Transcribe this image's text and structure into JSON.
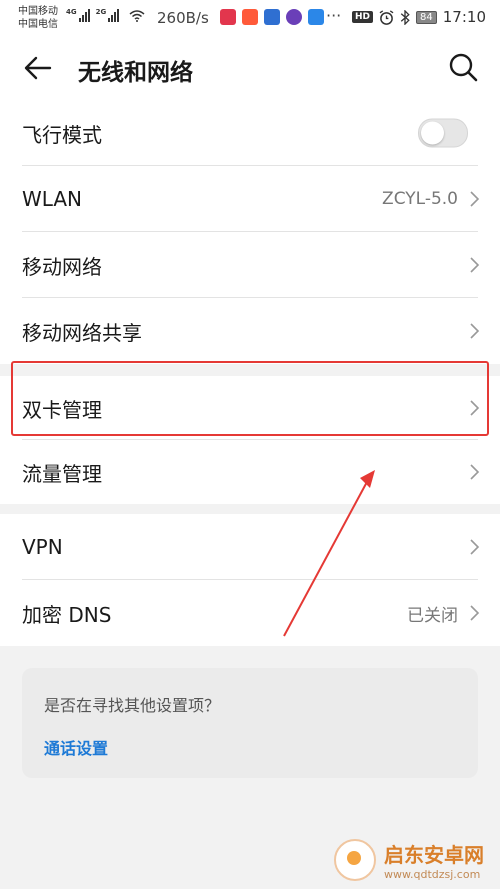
{
  "status_bar": {
    "carrier_1": "中国移动",
    "carrier_2": "中国电信",
    "net_1": "4G",
    "net_2": "2G",
    "speed": "260B/s",
    "more": "···",
    "hd": "HD",
    "battery": "84",
    "time": "17:10"
  },
  "header": {
    "title": "无线和网络"
  },
  "groups": {
    "g1": [
      {
        "label": "飞行模式",
        "toggle_on": false
      },
      {
        "label": "WLAN",
        "value": "ZCYL-5.0"
      },
      {
        "label": "移动网络"
      },
      {
        "label": "移动网络共享"
      }
    ],
    "g2": [
      {
        "label": "双卡管理"
      },
      {
        "label": "流量管理"
      }
    ],
    "g3": [
      {
        "label": "VPN"
      },
      {
        "label": "加密 DNS",
        "value": "已关闭"
      }
    ]
  },
  "suggestion": {
    "question": "是否在寻找其他设置项？",
    "link": "通话设置"
  },
  "watermark": {
    "name": "启东安卓网",
    "url": "www.qdtdzsj.com"
  },
  "colors": {
    "highlight": "#e53935",
    "link": "#1e7ad6",
    "background": "#f2f2f2"
  }
}
